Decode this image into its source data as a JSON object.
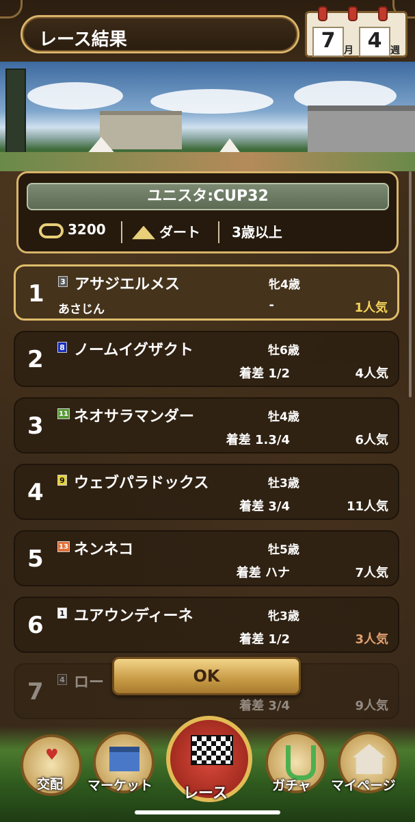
{
  "header": {
    "title": "レース結果",
    "calendar": {
      "month": "7",
      "month_unit": "月",
      "week": "4",
      "week_unit": "週"
    }
  },
  "race": {
    "name": "ユニスタ:CUP32",
    "distance": "3200",
    "surface": "ダート",
    "age_condition": "3歳以上"
  },
  "results": [
    {
      "rank": "1",
      "gate": "3",
      "gate_color": "#5a5a5a",
      "horse": "アサジエルメス",
      "sex_age": "牝4歳",
      "jockey": "あさじん",
      "margin": "-",
      "popularity": "1人気",
      "pop_color": "#f4d45a"
    },
    {
      "rank": "2",
      "gate": "8",
      "gate_color": "#1a2fc0",
      "horse": "ノームイグザクト",
      "sex_age": "牡6歳",
      "jockey": "",
      "margin": "着差 1/2",
      "popularity": "4人気",
      "pop_color": "#ffffff"
    },
    {
      "rank": "3",
      "gate": "11",
      "gate_color": "#5a9a3a",
      "horse": "ネオサラマンダー",
      "sex_age": "牡4歳",
      "jockey": "",
      "margin": "着差 1.3/4",
      "popularity": "6人気",
      "pop_color": "#ffffff"
    },
    {
      "rank": "4",
      "gate": "9",
      "gate_color": "#e8d23a",
      "horse": "ウェブパラドックス",
      "sex_age": "牡3歳",
      "jockey": "",
      "margin": "着差 3/4",
      "popularity": "11人気",
      "pop_color": "#ffffff"
    },
    {
      "rank": "5",
      "gate": "13",
      "gate_color": "#e0703a",
      "horse": "ネンネコ",
      "sex_age": "牡5歳",
      "jockey": "",
      "margin": "着差 ハナ",
      "popularity": "7人気",
      "pop_color": "#ffffff"
    },
    {
      "rank": "6",
      "gate": "1",
      "gate_color": "#f4f4f4",
      "horse": "ユアウンディーネ",
      "sex_age": "牝3歳",
      "jockey": "",
      "margin": "着差 1/2",
      "popularity": "3人気",
      "pop_color": "#e0a070"
    },
    {
      "rank": "7",
      "gate": "4",
      "gate_color": "#3a3a3a",
      "horse": "ロー",
      "sex_age": "",
      "jockey": "",
      "margin": "着差 3/4",
      "popularity": "9人気",
      "pop_color": "#ffffff"
    }
  ],
  "ok_button": "OK",
  "nav": {
    "breeding": "交配",
    "market": "マーケット",
    "race": "レース",
    "gacha": "ガチャ",
    "mypage": "マイページ"
  }
}
